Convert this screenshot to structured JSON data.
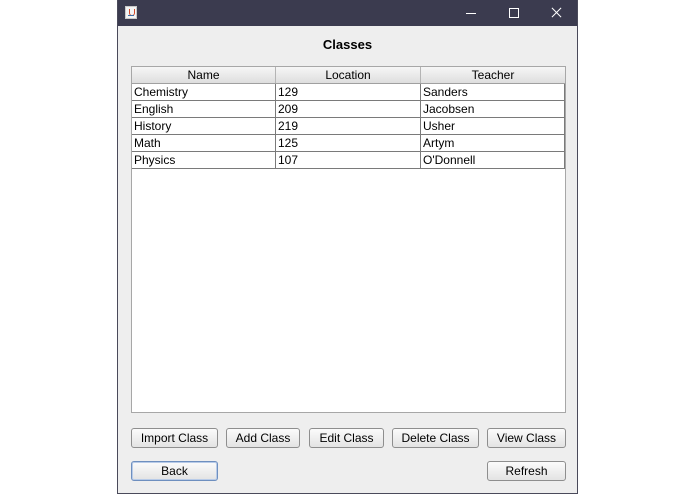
{
  "window": {
    "icon": "java-icon",
    "controls": [
      "minimize-icon",
      "maximize-icon",
      "close-icon"
    ]
  },
  "heading": "Classes",
  "table": {
    "columns": [
      "Name",
      "Location",
      "Teacher"
    ],
    "rows": [
      [
        "Chemistry",
        "129",
        "Sanders"
      ],
      [
        "English",
        "209",
        "Jacobsen"
      ],
      [
        "History",
        "219",
        "Usher"
      ],
      [
        "Math",
        "125",
        "Artym"
      ],
      [
        "Physics",
        "107",
        "O'Donnell"
      ]
    ]
  },
  "actions": {
    "import": "Import Class",
    "add": "Add Class",
    "edit": "Edit Class",
    "delete": "Delete Class",
    "view": "View Class",
    "back": "Back",
    "refresh": "Refresh"
  }
}
